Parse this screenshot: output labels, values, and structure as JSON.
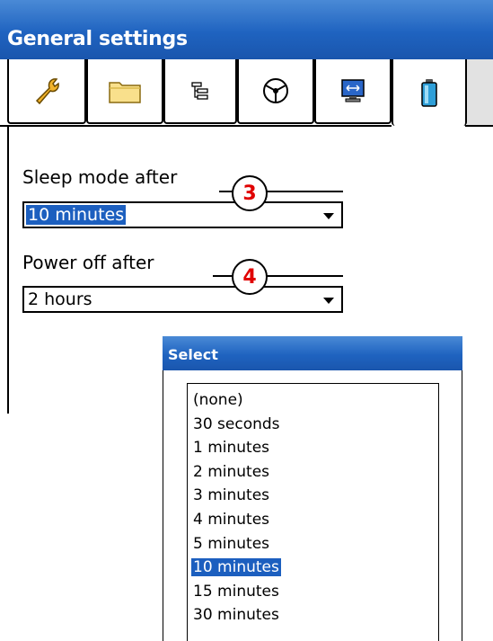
{
  "window": {
    "title": "General settings"
  },
  "tabs": [
    {
      "icon": "wrench-icon"
    },
    {
      "icon": "folder-icon"
    },
    {
      "icon": "tree-icon"
    },
    {
      "icon": "steering-wheel-icon"
    },
    {
      "icon": "monitor-icon"
    },
    {
      "icon": "battery-icon",
      "active": true
    }
  ],
  "sleep": {
    "label": "Sleep mode after",
    "value": "10 minutes",
    "callout": "3"
  },
  "power": {
    "label": "Power off after",
    "value": "2 hours",
    "callout": "4"
  },
  "popup": {
    "title": "Select",
    "options": [
      "(none)",
      "30 seconds",
      "1 minutes",
      "2 minutes",
      "3 minutes",
      "4 minutes",
      "5 minutes",
      "10 minutes",
      "15 minutes",
      "30 minutes"
    ],
    "selected": "10 minutes"
  },
  "colors": {
    "titlebar": "#1f63c0",
    "selection": "#1c5fbf",
    "callout_text": "#e00000"
  }
}
